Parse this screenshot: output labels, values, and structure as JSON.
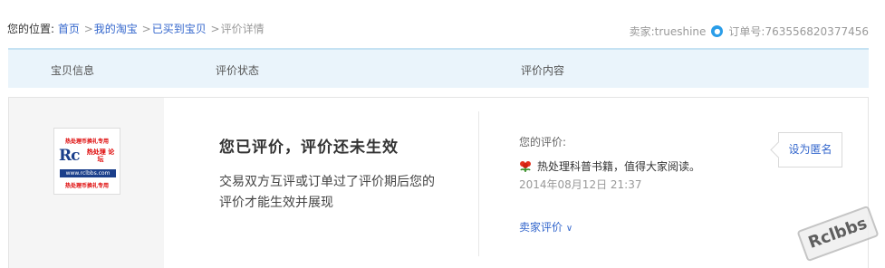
{
  "breadcrumb": {
    "prefix": "您的位置:",
    "items": [
      "首页",
      "我的淘宝",
      "已买到宝贝"
    ],
    "separator": ">",
    "current": "评价详情"
  },
  "seller_info": {
    "seller_label": "卖家:",
    "seller_name": "trueshine",
    "order_label": "订单号:",
    "order_number": "763556820377456",
    "chat_icon": "wangwang-icon"
  },
  "table_header": {
    "col1": "宝贝信息",
    "col2": "评价状态",
    "col3": "评价内容"
  },
  "item": {
    "thumb_line1": "热处理币换礼专用",
    "thumb_logo": "Rc",
    "thumb_logo_cn": "热处理 论坛",
    "thumb_url": "www.rclbbs.com",
    "thumb_line4": "热处理币换礼专用"
  },
  "status": {
    "title": "您已评价，评价还未生效",
    "description": "交易双方互评或订单过了评价期后您的评价才能生效并展现"
  },
  "review": {
    "your_review_label": "您的评价:",
    "rating_icon": "flower-icon",
    "text": "热处理科普书籍，值得大家阅读。",
    "date": "2014年08月12日 21:37",
    "seller_review_link": "卖家评价"
  },
  "anonymous_button": "设为匿名",
  "watermark_text": "Rclbbs",
  "colors": {
    "link": "#3366cc",
    "header_bg": "#eaf4fb",
    "header_border": "#c5e2f3"
  }
}
